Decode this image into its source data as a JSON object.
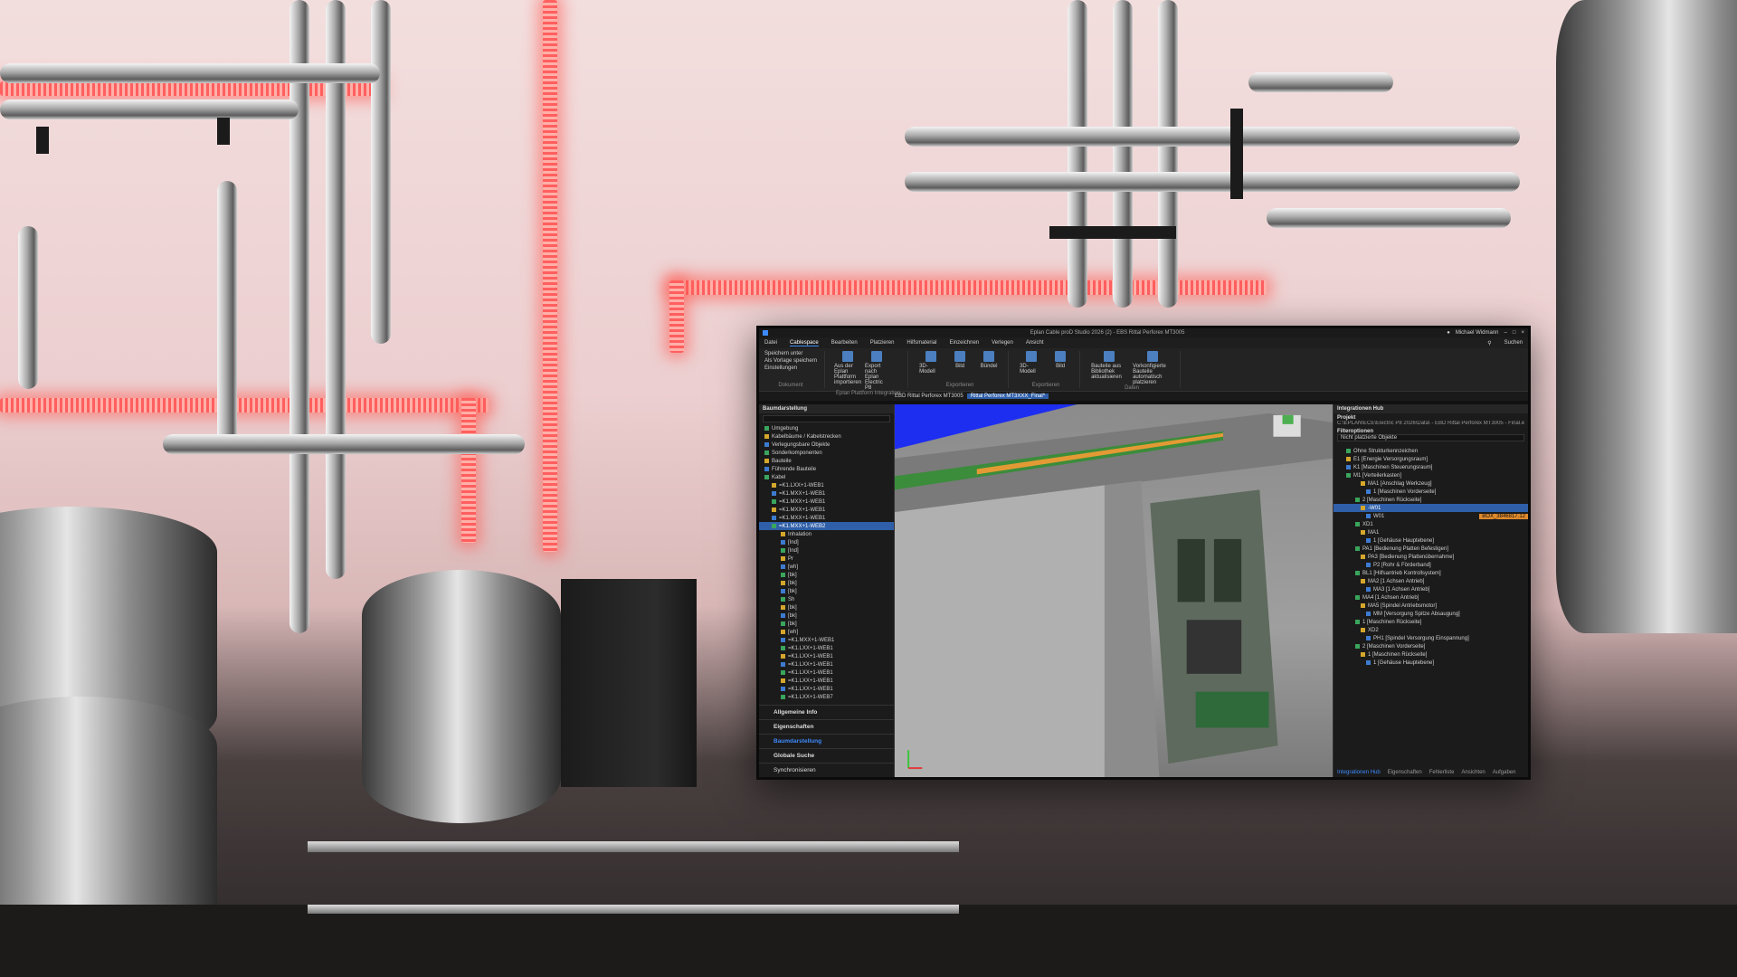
{
  "app": {
    "window_title": "Eplan Cable proD Studio 2026 (2) - EBS Rittal Perforex MT3005"
  },
  "titlebar": {
    "user_name": "Michael Widmann"
  },
  "menu": {
    "tabs": [
      {
        "label": "Datei"
      },
      {
        "label": "Cablespace",
        "active": true
      },
      {
        "label": "Bearbeiten"
      },
      {
        "label": "Platzieren"
      },
      {
        "label": "Hilfsmaterial"
      },
      {
        "label": "Einzeichnen"
      },
      {
        "label": "Verlegen"
      },
      {
        "label": "Ansicht"
      }
    ],
    "search_label": "Suchen"
  },
  "ribbon": {
    "groups": [
      {
        "label": "Dokument",
        "buttons": [
          {
            "label": "Speichern unter"
          },
          {
            "label": "Als Vorlage speichern"
          },
          {
            "label": "Einstellungen"
          }
        ]
      },
      {
        "label": "Eplan Plattform Integration",
        "buttons": [
          {
            "label": "Aus der Eplan Plattform importieren"
          },
          {
            "label": "Export nach Eplan Electric P8"
          }
        ]
      },
      {
        "label": "Exportieren",
        "buttons": [
          {
            "label": "3D-Modell"
          },
          {
            "label": "Bild"
          },
          {
            "label": "Bündel"
          }
        ]
      },
      {
        "label": "Exportieren",
        "buttons": [
          {
            "label": "3D-Modell"
          },
          {
            "label": "Bild"
          }
        ]
      },
      {
        "label": "Daten",
        "buttons": [
          {
            "label": "Bauteile aus Bibliothek aktualisieren"
          },
          {
            "label": "Vorkonfigierte Bauteile automatisch platzieren"
          }
        ]
      }
    ]
  },
  "doc_tabs": [
    {
      "label": "EBD Rittal Perforex MT3005"
    },
    {
      "label": "Rittal Perforex MT3XXX_Final*",
      "active": true
    }
  ],
  "left_panel": {
    "title": "Baumdarstellung",
    "tree": [
      {
        "label": "Umgebung"
      },
      {
        "label": "Kabelbäume / Kabelstrecken"
      },
      {
        "label": "Verlegungsbare Objekte"
      },
      {
        "label": "Sonderkomponenten"
      },
      {
        "label": "Bauteile"
      },
      {
        "label": "Führende Bauteile"
      },
      {
        "label": "Kabel"
      },
      {
        "label": "=K1.LXX+1-WEB1"
      },
      {
        "label": "=K1.MXX+1-WEB1"
      },
      {
        "label": "=K1.MXX+1-WEB1"
      },
      {
        "label": "=K1.MXX+1-WEB1"
      },
      {
        "label": "=K1.MXX+1-WEB1"
      },
      {
        "label": "=K1.MXX+1-WEB2",
        "selected": true
      },
      {
        "label": "Inhalation"
      },
      {
        "label": "[Ind]"
      },
      {
        "label": "[Ind]"
      },
      {
        "label": "Pr"
      },
      {
        "label": "[wh]"
      },
      {
        "label": "[bk]"
      },
      {
        "label": "[bk]"
      },
      {
        "label": "[bk]"
      },
      {
        "label": "Sh"
      },
      {
        "label": "[bk]"
      },
      {
        "label": "[bk]"
      },
      {
        "label": "[bk]"
      },
      {
        "label": "[wh]"
      },
      {
        "label": "=K1.MXX+1-WEB1"
      },
      {
        "label": "=K1.LXX+1-WEB1"
      },
      {
        "label": "=K1.LXX+1-WEB1"
      },
      {
        "label": "=K1.LXX+1-WEB1"
      },
      {
        "label": "=K1.LXX+1-WEB1"
      },
      {
        "label": "=K1.LXX+1-WEB1"
      },
      {
        "label": "=K1.LXX+1-WEB1"
      },
      {
        "label": "=K1.LXX+1-WEB7"
      }
    ],
    "sections": [
      {
        "label": "Allgemeine Info"
      },
      {
        "label": "Eigenschaften"
      },
      {
        "label": "Baumdarstellung",
        "selected": true
      },
      {
        "label": "Globale Suche"
      }
    ],
    "footer": "Synchronisieren"
  },
  "right_panel": {
    "title": "Integrationen Hub",
    "project_label": "Projekt",
    "project_path": "C:\\EPLAN\\ECE\\Electric P8 2026\\Data\\ - EBD Rittal Perforex MT3005 - Final.elk",
    "filter_label": "Filteroptionen",
    "filter_value": "Nicht platzierte Objekte",
    "tree": [
      {
        "label": "Ohne Strukturkennzeichen"
      },
      {
        "label": "E1 [Energie Versorgungsraum]"
      },
      {
        "label": "K1 [Maschinen Steuerungsraum]"
      },
      {
        "label": "M1 [Verteilerkasten]"
      },
      {
        "label": "MA1 [Anschlag Werkzeug]"
      },
      {
        "label": "1 [Maschinen Vorderseite]"
      },
      {
        "label": "2 [Maschinen Rückseite]"
      },
      {
        "label": "-W01",
        "selected": true
      },
      {
        "label": "W01"
      },
      {
        "label": "XD1"
      },
      {
        "label": "MA1"
      },
      {
        "label": "1 [Gehäuse Hauptebene]"
      },
      {
        "label": "PA1 [Bedienung Platten Befestigen]"
      },
      {
        "label": "PA3 [Bedienung Plattenübernahme]"
      },
      {
        "label": "P2 [Rohr & Förderband]"
      },
      {
        "label": "BL1 [Hilfsantrieb Kontrollsystem]"
      },
      {
        "label": "MA2 [1 Achsen Antrieb]"
      },
      {
        "label": "MA3 [1 Achsen Antrieb]"
      },
      {
        "label": "MA4 [1 Achsen Antrieb]"
      },
      {
        "label": "MA5 [Spindel Antriebsmotor]"
      },
      {
        "label": "MM [Versorgung Spitze Absaugung]"
      },
      {
        "label": "1 [Maschinen Rückseite]"
      },
      {
        "label": "XD2"
      },
      {
        "label": "PH1 [Spindel Versorgung Einspannung]"
      },
      {
        "label": "2 [Maschinen Vorderseite]"
      },
      {
        "label": "1 [Maschinen Rückseite]"
      },
      {
        "label": "1 [Gehäuse Hauptebene]"
      }
    ],
    "badge_label": "BOX_3846817.12",
    "footer_tabs": [
      {
        "label": "Integrationen Hub",
        "active": true
      },
      {
        "label": "Eigenschaften"
      },
      {
        "label": "Fehlerliste"
      },
      {
        "label": "Ansichten"
      },
      {
        "label": "Aufgaben"
      }
    ]
  },
  "colors": {
    "accent": "#3d8bfd",
    "selected_row": "#2f5fa8",
    "glow": "#ff5f5f",
    "wall": "#f0d6d6"
  }
}
